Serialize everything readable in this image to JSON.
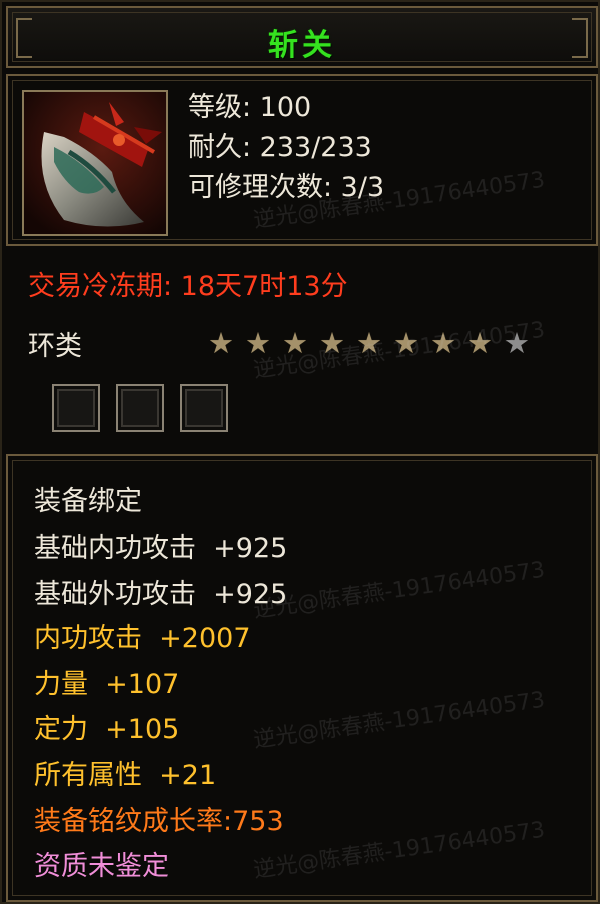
{
  "item": {
    "name": "斩关",
    "stats": {
      "level": "等级: 100",
      "durability": "耐久: 233/233",
      "repairs": "可修理次数: 3/3"
    },
    "trade_cooldown": "交易冷冻期: 18天7时13分",
    "category": "环类",
    "stars": {
      "filled": 8,
      "total": 9
    },
    "sockets": 3
  },
  "attributes": [
    {
      "text": "装备绑定",
      "color": "white"
    },
    {
      "text": "基础内功攻击  +925",
      "color": "white"
    },
    {
      "text": "基础外功攻击  +925",
      "color": "white"
    },
    {
      "text": "内功攻击  +2007",
      "color": "yellow"
    },
    {
      "text": "力量  +107",
      "color": "yellow"
    },
    {
      "text": "定力  +105",
      "color": "yellow"
    },
    {
      "text": "所有属性  +21",
      "color": "yellow"
    },
    {
      "text": "装备铭纹成长率:753",
      "color": "orange"
    },
    {
      "text": "资质未鉴定",
      "color": "pink"
    }
  ],
  "watermark": "逆光@陈春燕-19176440573",
  "colors": {
    "title": "#35e21f",
    "cooldown": "#ff3d1e",
    "white": "#ede7d9",
    "yellow": "#ffc12d",
    "orange": "#ff7a1a",
    "pink": "#f08ed8",
    "border": "#6b5a3c"
  }
}
